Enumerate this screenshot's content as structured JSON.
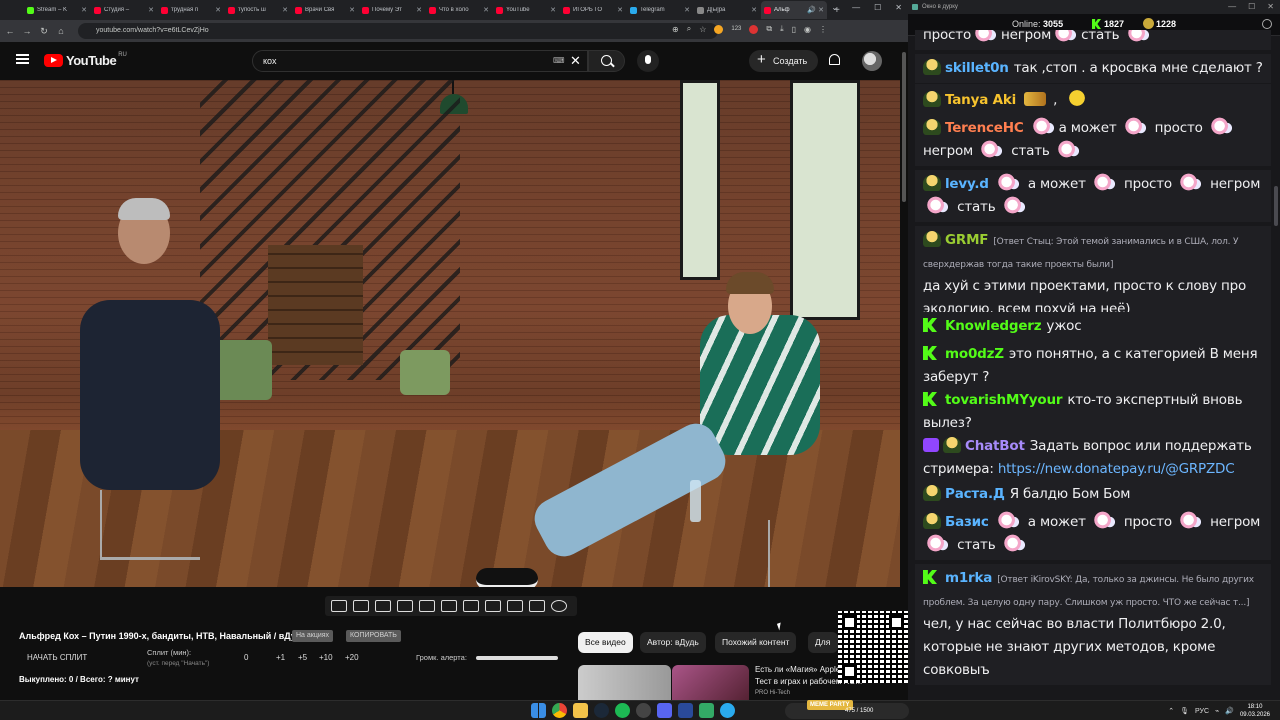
{
  "browser": {
    "tabs": [
      {
        "title": "Stream – K",
        "color": "#53fc18"
      },
      {
        "title": "Студия –",
        "color": "#ff0033"
      },
      {
        "title": "трудная п",
        "color": "#ff0033"
      },
      {
        "title": "тупость ш",
        "color": "#ff0033"
      },
      {
        "title": "Врачи Свя",
        "color": "#ff0033"
      },
      {
        "title": "Почему Эт",
        "color": "#ff0033"
      },
      {
        "title": "Что в холо",
        "color": "#ff0033"
      },
      {
        "title": "YouTube",
        "color": "#ff0033"
      },
      {
        "title": "ИГОРЬ ГО",
        "color": "#ff0033"
      },
      {
        "title": "Telegram",
        "color": "#2aabee"
      },
      {
        "title": "Д[ы]ра",
        "color": "#888888"
      },
      {
        "title": "Альф",
        "color": "#ff0033",
        "active": true
      }
    ],
    "new_tab": "+",
    "url": "youtube.com/watch?v=e6tLCevZjHo",
    "ext_badge_1": "123"
  },
  "youtube": {
    "wordmark": "YouTube",
    "region": "RU",
    "search_value": "кох",
    "create_label": "Создать",
    "video_title": "Альфред Кох – Путин 1990-х, бандиты, НТВ, Навальный / вДудь",
    "chip_sale": "На акциях",
    "chip_copy": "КОПИРОВАТЬ",
    "split_start": "НАЧАТЬ СПЛИТ",
    "split_min_label": "Сплит (мин):",
    "split_hint": "(уст. перед \"Начать\")",
    "split_buttons": [
      "0",
      "+1",
      "+5",
      "+10",
      "+20"
    ],
    "alert_volume_label": "Громк. алерта:",
    "alert_volume": 1.0,
    "bought": "Выкуплено: 0 / Всего: ? минут",
    "related_chips": [
      "Все видео",
      "Автор: вДудь",
      "Похожий контент",
      "Для в"
    ],
    "rec_title_1": "Есть ли «Магия» Apple",
    "rec_title_2": "Тест в играх и рабочем ПО...",
    "rec_sub": "PRO Hi-Tech"
  },
  "chat": {
    "window_title": "Окно в дурку",
    "online_label": "Online:",
    "online_count": "3055",
    "kick_count": "1827",
    "bot_count": "1228",
    "messages": [
      {
        "user": "",
        "color": "#efeff1",
        "text": "просто  негром  стать"
      },
      {
        "user": "skillet0n",
        "color": "#5ab4ff",
        "badge": "bot",
        "text": "так ,стоп . а кросвка мне сделают ?"
      },
      {
        "user": "Tanya Aki",
        "color": "#f7c32e",
        "badge": "bot",
        "text": ","
      },
      {
        "user": "TerenceHC",
        "color": "#ff7f50",
        "badge": "bot",
        "text": "а может  просто  негром  стать"
      },
      {
        "user": "levy.d",
        "color": "#5ab4ff",
        "badge": "bot",
        "text": "а может  просто  негром  стать"
      },
      {
        "user": "GRMF",
        "color": "#9acd32",
        "badge": "bot",
        "reply": "[Ответ Стыц: Этой темой занимались и в США, лол. У сверхдержав тогда такие проекты были]",
        "text": "да хуй с этими проектами, просто к слову про экологию, всем похуй на неё)"
      },
      {
        "user": "Knowledgerz",
        "color": "#53fc18",
        "badge": "k",
        "text": "ужос"
      },
      {
        "user": "mo0dzZ",
        "color": "#53fc18",
        "badge": "k",
        "text": "это понятно, а с категорией В меня заберут ?"
      },
      {
        "user": "tovarishMYyour",
        "color": "#53fc18",
        "badge": "k",
        "text": "кто-то экспертный вновь вылез?"
      },
      {
        "user": "ChatBot",
        "color": "#a78bfa",
        "badge": "mod",
        "text": "Задать вопрос или поддержать стримера:",
        "link": "https://new.donatepay.ru/@GRPZDC"
      },
      {
        "user": "Раста.Д",
        "color": "#5ab4ff",
        "badge": "bot",
        "text": "Я балдю Бом Бом"
      },
      {
        "user": "Базис",
        "color": "#5ab4ff",
        "badge": "bot",
        "text": "а может  просто  негром  стать"
      },
      {
        "user": "m1rka",
        "color": "#5ab4ff",
        "badge": "k",
        "reply": "[Ответ iKirovSKY: Да, только за джинсы. Не было других проблем. За целую одну пару. Слишком уж просто. ЧТО же сейчас т...]",
        "text": "чел, у нас сейчас во власти Политбюро 2.0, которые не знают других методов, кроме совковыъ"
      }
    ]
  },
  "taskbar": {
    "widget_label": "MEME PARTY",
    "widget_count": "475 / 1500",
    "lang": "РУС",
    "time": "18:10",
    "date": "09.03.2026"
  }
}
